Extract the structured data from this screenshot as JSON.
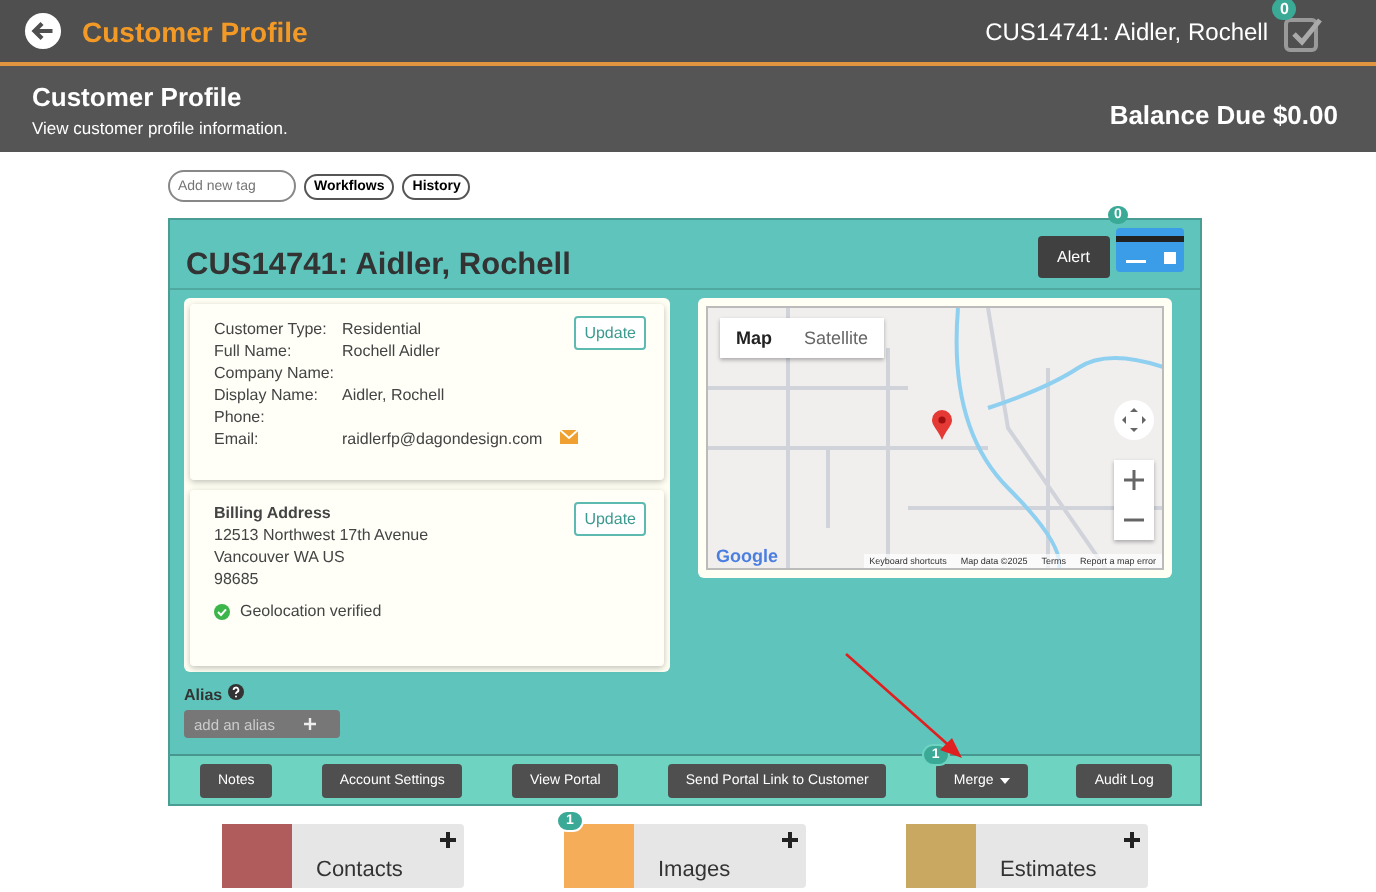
{
  "topbar": {
    "title": "Customer Profile",
    "customer": "CUS14741:  Aidler, Rochell",
    "badge": "0"
  },
  "header": {
    "title": "Customer Profile",
    "subtitle": "View customer profile information.",
    "balance": "Balance Due $0.00"
  },
  "tags": {
    "placeholder": "Add new tag",
    "buttons": [
      "Workflows",
      "History"
    ]
  },
  "panel": {
    "title": "CUS14741: Aidler, Rochell",
    "alert": "Alert",
    "card_badge": "0",
    "info": {
      "update": "Update",
      "rows": [
        {
          "label": "Customer Type:",
          "value": "Residential",
          "kind": "text"
        },
        {
          "label": "Full Name:",
          "value": "Rochell Aidler",
          "kind": "text"
        },
        {
          "label": "Company Name:",
          "kind": "text"
        },
        {
          "label": "Display Name:",
          "value": "Aidler, Rochell",
          "kind": "text"
        },
        {
          "label": "Phone:",
          "kind": "text"
        },
        {
          "label": "Email:",
          "value": "raidlerfp@dagondesign.com",
          "kind": "email"
        }
      ]
    },
    "billing": {
      "heading": "Billing Address",
      "update": "Update",
      "lines": [
        "12513 Northwest 17th Avenue",
        "Vancouver WA US",
        "98685"
      ],
      "geo": "Geolocation verified",
      "verified": true
    },
    "map": {
      "tabs": [
        {
          "label": "Map",
          "selected": true
        },
        {
          "label": "Satellite",
          "selected": false
        }
      ],
      "logo": "Google",
      "attribution": [
        "Keyboard shortcuts",
        "Map data ©2025",
        "Terms",
        "Report a map error"
      ]
    },
    "alias": {
      "label": "Alias",
      "placeholder": "add an alias"
    },
    "actions": [
      {
        "label": "Notes",
        "kind": "button"
      },
      {
        "label": "Account Settings",
        "kind": "button"
      },
      {
        "label": "View Portal",
        "kind": "button"
      },
      {
        "label": "Send Portal Link to Customer",
        "kind": "button"
      },
      {
        "label": "Merge",
        "kind": "dropdown",
        "badge": "1"
      },
      {
        "label": "Audit Log",
        "kind": "button"
      }
    ]
  },
  "tiles": [
    {
      "label": "Contacts",
      "color": "#b05c5c"
    },
    {
      "label": "Images",
      "color": "#f5ad5a",
      "badge": "1"
    },
    {
      "label": "Estimates",
      "color": "#c9a862"
    }
  ]
}
